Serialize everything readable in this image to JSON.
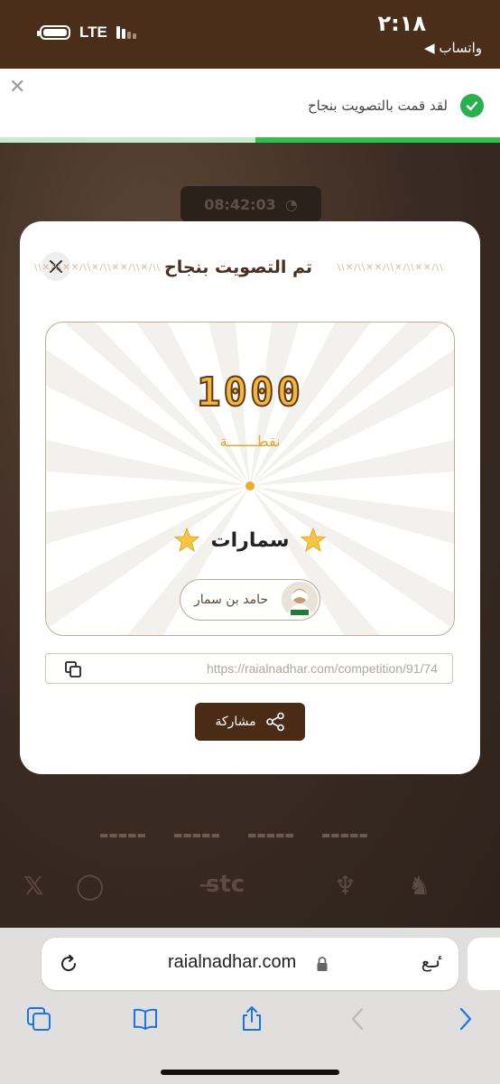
{
  "status_bar": {
    "time": "٢:١٨",
    "back_app": "◀ واتساب",
    "network": "LTE"
  },
  "toast": {
    "message": "لقد قمت بالتصويت بنجاح",
    "progress": 0.49,
    "colors": {
      "check": "#26b14a",
      "progress": "#2fbf4a"
    }
  },
  "background": {
    "timer": "08:42:03"
  },
  "modal": {
    "title": "تم التصويت بنجاح",
    "points_value": "1000",
    "points_label": "نقطـــــــة",
    "song_title": "سمارات",
    "artist_name": "حامد بن سمار",
    "link_url": "https://raialnadhar.com/competition/91/74",
    "share_label": "مشاركة",
    "colors": {
      "brand_brown": "#4a2c16",
      "gold": "#f5b638"
    }
  },
  "browser": {
    "address": "raialnadhar.com",
    "text_size": "ٸع"
  }
}
